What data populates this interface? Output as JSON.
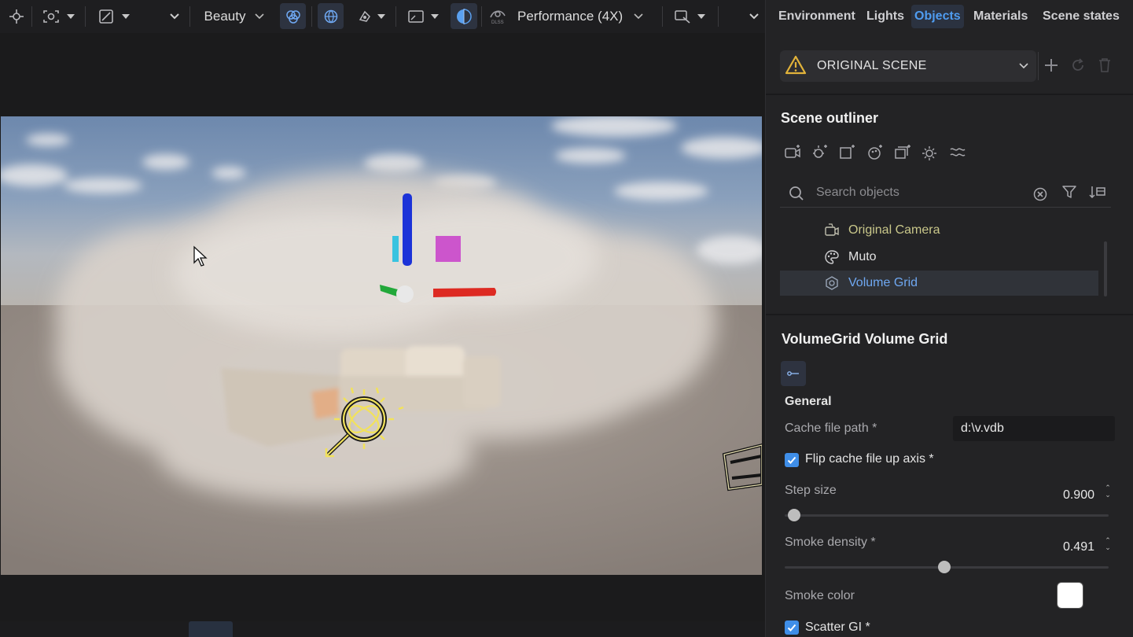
{
  "toolbar": {
    "render_mode": "Beauty",
    "performance": "Performance (4X)",
    "icons": [
      "crosshair-icon",
      "target-icon",
      "edit-image-icon",
      "dropdown-icon",
      "blend-icon",
      "globe-icon",
      "lighting-icon",
      "aspect-icon",
      "dlss-icon",
      "snapshot-icon",
      "overflow-icon"
    ],
    "dlss_badge": "DLSS"
  },
  "tabs": [
    {
      "label": "Environment",
      "active": false
    },
    {
      "label": "Lights",
      "active": false
    },
    {
      "label": "Objects",
      "active": true
    },
    {
      "label": "Materials",
      "active": false
    },
    {
      "label": "Scene states",
      "active": false
    }
  ],
  "scene": {
    "selected": "ORIGINAL SCENE",
    "warning_icon": "warning-icon"
  },
  "outliner": {
    "title": "Scene outliner",
    "search_placeholder": "Search objects",
    "items": [
      {
        "label": "Original Camera",
        "icon": "camera-icon",
        "color": "#c9c78a",
        "selected": false
      },
      {
        "label": "Muto",
        "icon": "palette-icon",
        "color": "#e2e2e2",
        "selected": false
      },
      {
        "label": "Volume Grid",
        "icon": "volume-icon",
        "color": "#6fa8f2",
        "selected": true
      }
    ]
  },
  "properties": {
    "title": "VolumeGrid Volume Grid",
    "section": "General",
    "cache_label": "Cache file path *",
    "cache_value": "d:\\v.vdb",
    "flip_label": "Flip cache file up axis *",
    "flip_checked": true,
    "step_label": "Step size",
    "step_value": "0.900",
    "step_fraction": 0.0,
    "density_label": "Smoke density *",
    "density_value": "0.491",
    "density_fraction": 0.491,
    "color_label": "Smoke color",
    "color_value": "#ffffff",
    "scatter_label": "Scatter GI *",
    "scatter_checked": true
  }
}
